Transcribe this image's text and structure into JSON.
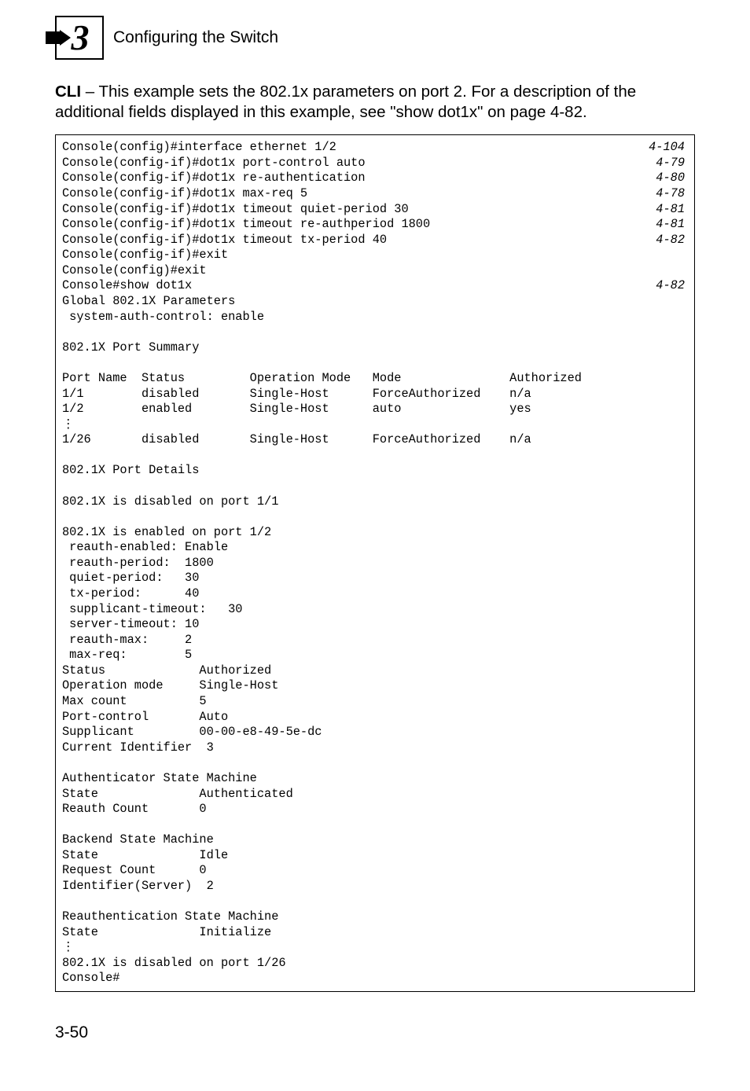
{
  "header": {
    "chapter_number": "3",
    "title": "Configuring the Switch"
  },
  "intro": {
    "para": "CLI – This example sets the 802.1x parameters on port 2. For a description of the additional fields displayed in this example, see \"show dot1x\" on page 4-82.",
    "bold_lead": "CLI"
  },
  "cli": {
    "config_lines": [
      {
        "cmd": "Console(config)#interface ethernet 1/2",
        "ref": "4-104"
      },
      {
        "cmd": "Console(config-if)#dot1x port-control auto",
        "ref": "4-79"
      },
      {
        "cmd": "Console(config-if)#dot1x re-authentication",
        "ref": "4-80"
      },
      {
        "cmd": "Console(config-if)#dot1x max-req 5",
        "ref": "4-78"
      },
      {
        "cmd": "Console(config-if)#dot1x timeout quiet-period 30",
        "ref": "4-81"
      },
      {
        "cmd": "Console(config-if)#dot1x timeout re-authperiod 1800",
        "ref": "4-81"
      },
      {
        "cmd": "Console(config-if)#dot1x timeout tx-period 40",
        "ref": "4-82"
      },
      {
        "cmd": "Console(config-if)#exit",
        "ref": ""
      },
      {
        "cmd": "Console(config)#exit",
        "ref": ""
      },
      {
        "cmd": "Console#show dot1x",
        "ref": "4-82"
      }
    ],
    "body": "Global 802.1X Parameters\n system-auth-control: enable\n\n802.1X Port Summary\n\nPort Name  Status         Operation Mode   Mode               Authorized\n1/1        disabled       Single-Host      ForceAuthorized    n/a\n1/2        enabled        Single-Host      auto               yes",
    "ell1": "⋮",
    "body2": "1/26       disabled       Single-Host      ForceAuthorized    n/a\n\n802.1X Port Details\n\n802.1X is disabled on port 1/1\n\n802.1X is enabled on port 1/2\n reauth-enabled: Enable\n reauth-period:  1800\n quiet-period:   30\n tx-period:      40\n supplicant-timeout:   30\n server-timeout: 10\n reauth-max:     2\n max-req:        5\nStatus             Authorized\nOperation mode     Single-Host\nMax count          5\nPort-control       Auto\nSupplicant         00-00-e8-49-5e-dc\nCurrent Identifier  3\n\nAuthenticator State Machine\nState              Authenticated\nReauth Count       0\n\nBackend State Machine\nState              Idle\nRequest Count      0\nIdentifier(Server)  2\n\nReauthentication State Machine\nState              Initialize",
    "ell2": "⋮",
    "body3": "802.1X is disabled on port 1/26\nConsole#"
  },
  "page_number": "3-50"
}
